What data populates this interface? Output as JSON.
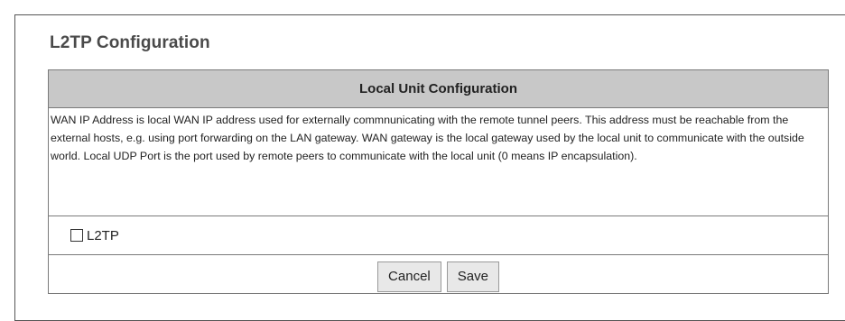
{
  "page": {
    "title": "L2TP Configuration"
  },
  "section": {
    "header": "Local Unit Configuration",
    "description": "WAN IP Address is local WAN IP address used for externally commnunicating with the remote tunnel peers. This address must be reachable from the external hosts, e.g. using port forwarding on the LAN gateway. WAN gateway is the local gateway used by the local unit to communicate with the outside world. Local UDP Port is the port used by remote peers to communicate with the local unit (0 means IP encapsulation)."
  },
  "l2tp_checkbox": {
    "label": "L2TP",
    "checked": false
  },
  "buttons": {
    "cancel_label": "Cancel",
    "save_label": "Save"
  }
}
